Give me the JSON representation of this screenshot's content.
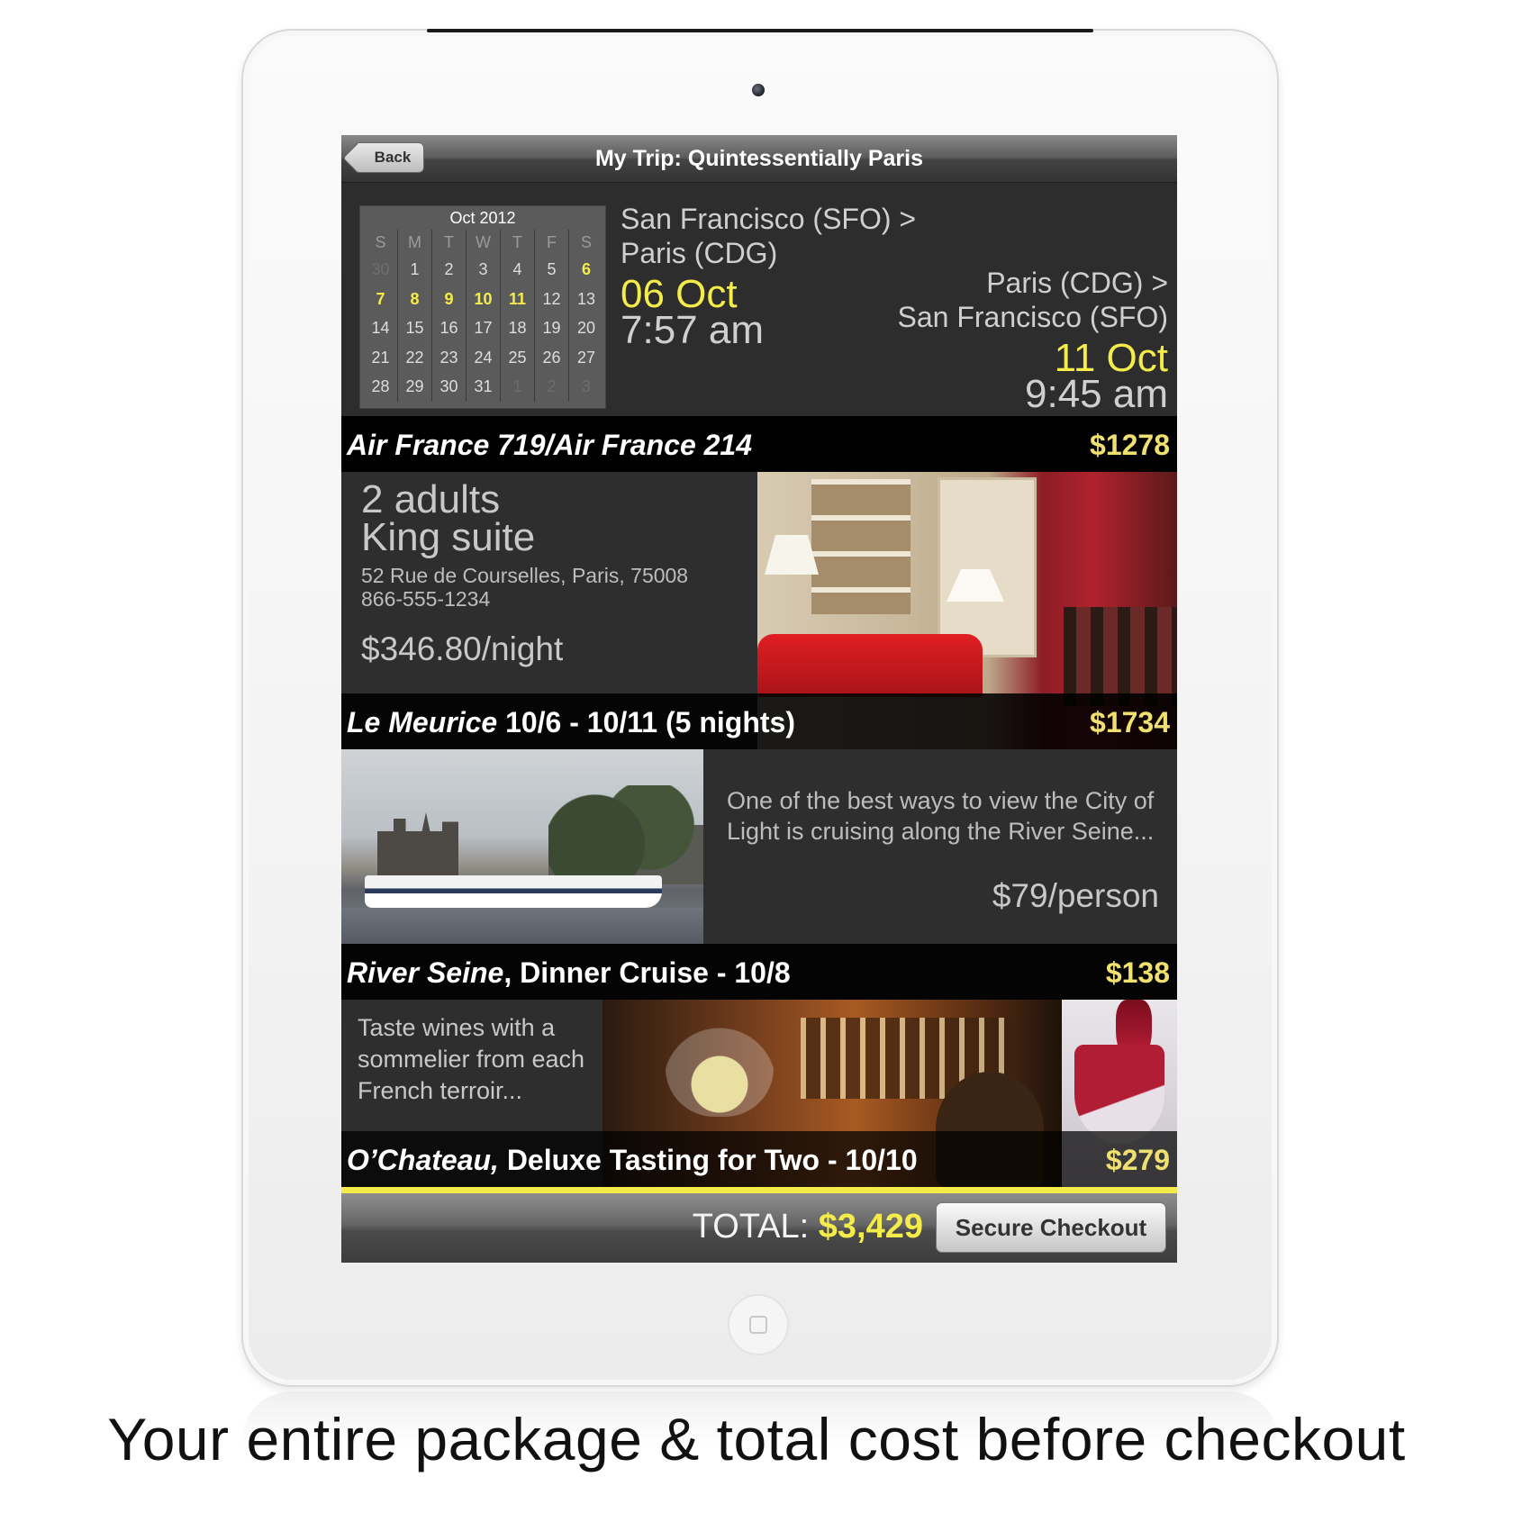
{
  "caption": "Your entire package & total cost before checkout",
  "navbar": {
    "back_label": "Back",
    "title": "My Trip: Quintessentially Paris"
  },
  "calendar": {
    "title": "Oct 2012",
    "weekdays": [
      "S",
      "M",
      "T",
      "W",
      "T",
      "F",
      "S"
    ],
    "days": [
      {
        "d": "30",
        "state": "dim"
      },
      {
        "d": "1",
        "state": ""
      },
      {
        "d": "2",
        "state": ""
      },
      {
        "d": "3",
        "state": ""
      },
      {
        "d": "4",
        "state": ""
      },
      {
        "d": "5",
        "state": ""
      },
      {
        "d": "6",
        "state": "hl"
      },
      {
        "d": "7",
        "state": "hl"
      },
      {
        "d": "8",
        "state": "hl"
      },
      {
        "d": "9",
        "state": "hl"
      },
      {
        "d": "10",
        "state": "hl"
      },
      {
        "d": "11",
        "state": "hl"
      },
      {
        "d": "12",
        "state": ""
      },
      {
        "d": "13",
        "state": ""
      },
      {
        "d": "14",
        "state": ""
      },
      {
        "d": "15",
        "state": ""
      },
      {
        "d": "16",
        "state": ""
      },
      {
        "d": "17",
        "state": ""
      },
      {
        "d": "18",
        "state": ""
      },
      {
        "d": "19",
        "state": ""
      },
      {
        "d": "20",
        "state": ""
      },
      {
        "d": "21",
        "state": ""
      },
      {
        "d": "22",
        "state": ""
      },
      {
        "d": "23",
        "state": ""
      },
      {
        "d": "24",
        "state": ""
      },
      {
        "d": "25",
        "state": ""
      },
      {
        "d": "26",
        "state": ""
      },
      {
        "d": "27",
        "state": ""
      },
      {
        "d": "28",
        "state": ""
      },
      {
        "d": "29",
        "state": ""
      },
      {
        "d": "30",
        "state": ""
      },
      {
        "d": "31",
        "state": ""
      },
      {
        "d": "1",
        "state": "dim"
      },
      {
        "d": "2",
        "state": "dim"
      },
      {
        "d": "3",
        "state": "dim"
      }
    ]
  },
  "flight": {
    "outbound": {
      "route_line1": "San Francisco (SFO) >",
      "route_line2": "Paris (CDG)",
      "date": "06 Oct",
      "time": "7:57 am"
    },
    "return": {
      "route_line1": "Paris (CDG) >",
      "route_line2": "San Francisco (SFO)",
      "date": "11 Oct",
      "time": "9:45 am"
    },
    "bar_label": "Air France 719/Air France 214",
    "price": "$1278"
  },
  "hotel": {
    "guests": "2 adults",
    "room": "King suite",
    "address": "52 Rue de Courselles, Paris, 75008",
    "phone": "866-555-1234",
    "rate": "$346.80/night",
    "bar_name": "Le Meurice",
    "bar_dates": " 10/6 - 10/11 (5 nights)",
    "price": "$1734"
  },
  "cruise": {
    "description": "One of the best ways to view the City of Light is cruising along the River Seine...",
    "rate": "$79/person",
    "bar_name": "River Seine",
    "bar_detail": ", Dinner Cruise - 10/8",
    "price": "$138"
  },
  "wine": {
    "description": "Taste wines with a sommelier from each French terroir...",
    "bar_name": "O’Chateau,",
    "bar_detail": " Deluxe Tasting for Two - 10/10",
    "price": "$279"
  },
  "toolbar": {
    "total_label": "TOTAL: ",
    "total_amount": "$3,429",
    "checkout_label": "Secure Checkout"
  },
  "colors": {
    "accent_yellow": "#f4ec4a",
    "price_yellow": "#f0e070",
    "panel_bg": "#2e2e2e"
  }
}
